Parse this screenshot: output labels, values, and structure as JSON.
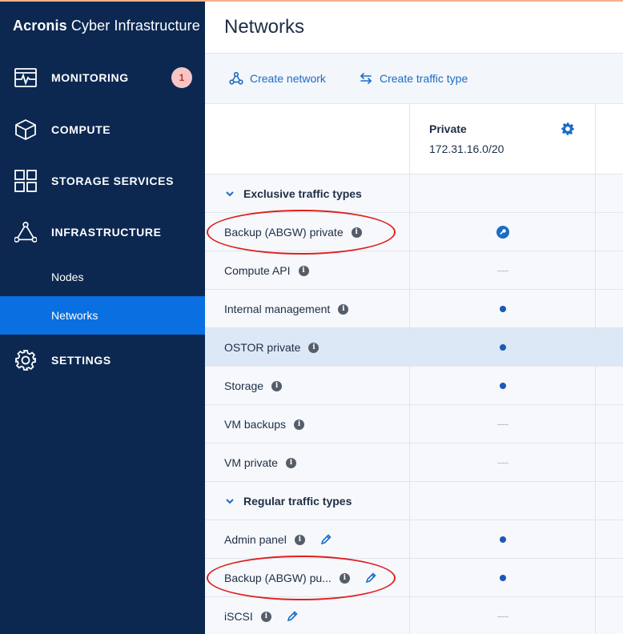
{
  "brand": {
    "bold": "Acronis",
    "light": " Cyber Infrastructure"
  },
  "sidebar": {
    "items": [
      {
        "label": "MONITORING",
        "icon": "monitoring-icon",
        "badge": "1"
      },
      {
        "label": "COMPUTE",
        "icon": "cube-icon"
      },
      {
        "label": "STORAGE SERVICES",
        "icon": "grid-icon"
      },
      {
        "label": "INFRASTRUCTURE",
        "icon": "triangle-network-icon"
      },
      {
        "label": "SETTINGS",
        "icon": "gear-icon"
      }
    ],
    "sub_items": [
      {
        "label": "Nodes",
        "active": false
      },
      {
        "label": "Networks",
        "active": true
      }
    ]
  },
  "page": {
    "title": "Networks"
  },
  "toolbar": {
    "create_network": "Create network",
    "create_traffic_type": "Create traffic type"
  },
  "network": {
    "name": "Private",
    "cidr": "172.31.16.0/20"
  },
  "sections": {
    "exclusive": "Exclusive traffic types",
    "regular": "Regular traffic types"
  },
  "exclusive_rows": [
    {
      "name": "Backup (ABGW) private",
      "state": "key"
    },
    {
      "name": "Compute API",
      "state": "none"
    },
    {
      "name": "Internal management",
      "state": "assigned"
    },
    {
      "name": "OSTOR private",
      "state": "assigned",
      "highlighted": true
    },
    {
      "name": "Storage",
      "state": "assigned"
    },
    {
      "name": "VM backups",
      "state": "none"
    },
    {
      "name": "VM private",
      "state": "none"
    }
  ],
  "regular_rows": [
    {
      "name": "Admin panel",
      "state": "assigned",
      "editable": true
    },
    {
      "name": "Backup (ABGW) pu...",
      "state": "assigned",
      "editable": true
    },
    {
      "name": "iSCSI",
      "state": "none",
      "editable": true
    }
  ],
  "colors": {
    "sidebar": "#0c2851",
    "active": "#0a6fe0",
    "link": "#1c6cc4",
    "annotation": "#e02020"
  }
}
